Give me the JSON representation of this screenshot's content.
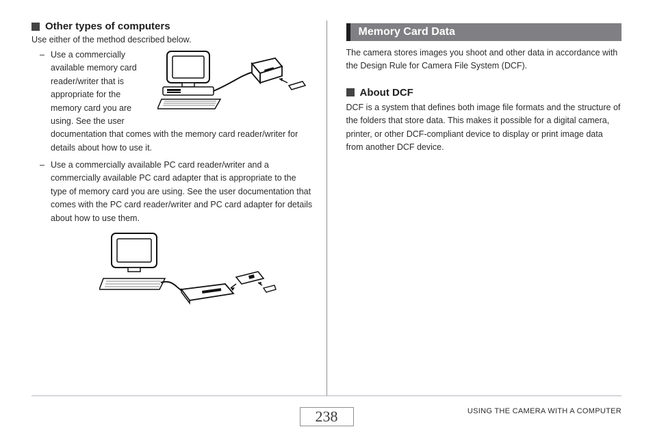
{
  "left": {
    "heading": "Other types of computers",
    "intro": "Use either of the method described below.",
    "bullet1_pre": "Use a commercially available memory card reader/writer that is appropriate for the memory card you are using. See the user",
    "bullet1_post": "documentation that comes with the memory card reader/writer for details about how to use it.",
    "bullet2": "Use a commercially available PC card reader/writer and a commercially available PC card adapter that is appropriate to the type of memory card you are using. See the user documentation that comes with the PC card reader/writer and PC card adapter for details about how to use them."
  },
  "right": {
    "section_title": "Memory Card Data",
    "para1": "The camera stores images you shoot and other data in accordance with the Design Rule for Camera File System (DCF).",
    "sub_heading": "About DCF",
    "para2": "DCF is a system that defines both image file formats and the structure of the folders that store data. This makes it possible for a digital camera, printer, or other DCF-compliant device to display or print image data from another DCF device."
  },
  "footer": {
    "page_number": "238",
    "running_title": "USING THE CAMERA WITH A COMPUTER"
  }
}
